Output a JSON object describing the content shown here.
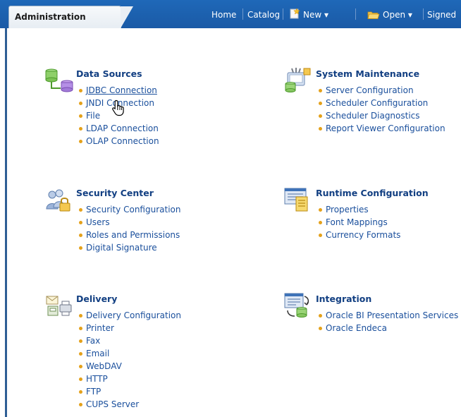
{
  "header": {
    "tab_label": "Administration",
    "nav": [
      "Home",
      "Catalog"
    ],
    "new_label": "New ▾",
    "open_label": "Open ▾",
    "signed_label": "Signed"
  },
  "sections": [
    {
      "title": "Data Sources",
      "icon": "database-icon",
      "items": [
        "JDBC Connection",
        "JNDI Connection",
        "File",
        "LDAP Connection",
        "OLAP Connection"
      ]
    },
    {
      "title": "System Maintenance",
      "icon": "maintenance-icon",
      "items": [
        "Server Configuration",
        "Scheduler Configuration",
        "Scheduler Diagnostics",
        "Report Viewer Configuration"
      ]
    },
    {
      "title": "Security Center",
      "icon": "security-icon",
      "items": [
        "Security Configuration",
        "Users",
        "Roles and Permissions",
        "Digital Signature"
      ]
    },
    {
      "title": "Runtime Configuration",
      "icon": "runtime-config-icon",
      "items": [
        "Properties",
        "Font Mappings",
        "Currency Formats"
      ]
    },
    {
      "title": "Delivery",
      "icon": "delivery-icon",
      "items": [
        "Delivery Configuration",
        "Printer",
        "Fax",
        "Email",
        "WebDAV",
        "HTTP",
        "FTP",
        "CUPS Server"
      ]
    },
    {
      "title": "Integration",
      "icon": "integration-icon",
      "items": [
        "Oracle BI Presentation Services",
        "Oracle Endeca"
      ]
    }
  ],
  "colors": {
    "accent": "#1e64b3",
    "link": "#1a4f9c",
    "title": "#123f82",
    "bullet": "#e4a11b"
  }
}
